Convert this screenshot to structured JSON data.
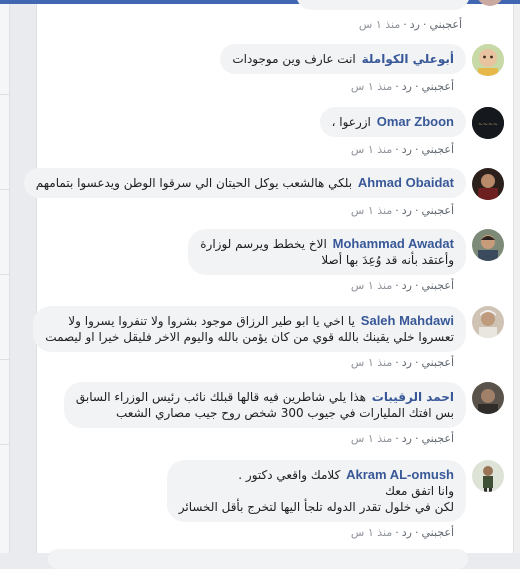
{
  "comments": [
    {
      "author": "",
      "text": "",
      "actions": {
        "like": "أعجبني",
        "reply": "رد",
        "time": "منذ ١ س"
      },
      "avatar_color": "#c9a9a0"
    },
    {
      "author": "أبوعلي الكواملة",
      "text": "انت عارف وين موجودات",
      "actions": {
        "like": "أعجبني",
        "reply": "رد",
        "time": "منذ ١ س"
      },
      "avatar_color": "#d8b18a"
    },
    {
      "author": "Omar Zboon",
      "text": "ازرعوا ،",
      "actions": {
        "like": "أعجبني",
        "reply": "رد",
        "time": "منذ ١ س"
      },
      "avatar_color": "#1b1e24"
    },
    {
      "author": "Ahmad Obaidat",
      "text": "بلكي هالشعب يوكل الحيتان الي سرقوا الوطن ويدعسوا بتمامهم",
      "actions": {
        "like": "أعجبني",
        "reply": "رد",
        "time": "منذ ١ س"
      },
      "avatar_color": "#3a2d27"
    },
    {
      "author": "Mohammad Awadat",
      "lines": [
        "الاخ يخطط ويرسم لوزارة",
        "وأعتقد بأنه قد وُعِدَ بها أصلا"
      ],
      "actions": {
        "like": "أعجبني",
        "reply": "رد",
        "time": "منذ ١ س"
      },
      "avatar_color": "#4c5a4a"
    },
    {
      "author": "Saleh Mahdawi",
      "lines": [
        "يا اخي يا ابو طير الرزاق موجود بشروا ولا تنفروا يسروا ولا",
        "تعسروا خلي يقينك بالله قوي من كان يؤمن بالله واليوم الاخر فليقل خيرا او ليصمت"
      ],
      "actions": {
        "like": "أعجبني",
        "reply": "رد",
        "time": "منذ ١ س"
      },
      "avatar_color": "#b9a48f"
    },
    {
      "author": "احمد الرقيبات",
      "lines": [
        "هذا يلي شاطرين فيه قالها قبلك نائب رئيس الوزراء السابق",
        "بس افتك المليارات في جيوب 300 شخص روح جيب مصاري الشعب"
      ],
      "actions": {
        "like": "أعجبني",
        "reply": "رد",
        "time": "منذ ١ س"
      },
      "avatar_color": "#55504a"
    },
    {
      "author": "Akram AL-omush",
      "lines": [
        "كلامك واقعي دكتور .",
        "وانا اتفق معك",
        "لكن في خلول تقدر الدوله تلجأ اليها لتخرج بأقل الخسائر"
      ],
      "actions": {
        "like": "أعجبني",
        "reply": "رد",
        "time": "منذ ١ س"
      },
      "avatar_color": "#5b6b55"
    }
  ]
}
